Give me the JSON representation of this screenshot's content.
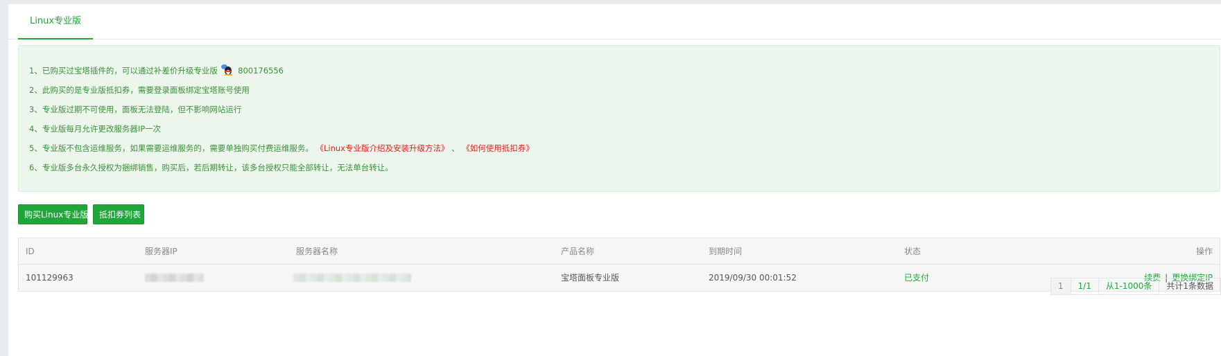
{
  "tab": {
    "label": "Linux专业版"
  },
  "notice": {
    "items": [
      "1、已购买过宝塔插件的，可以通过补差价升级专业版",
      "2、此购买的是专业版抵扣券，需要登录面板绑定宝塔账号使用",
      "3、专业版过期不可使用，面板无法登陆，但不影响网站运行",
      "4、专业版每月允许更改服务器IP一次",
      "5、专业版不包含运维服务，如果需要运维服务的，需要单独购买付费运维服务。",
      "6、专业版多台永久授权为捆绑销售，购买后，若后期转让，该多台授权只能全部转让，无法单台转让。"
    ],
    "qq_number": "800176556",
    "qq_icon": "qq-penguin-icon",
    "link_intro": "《Linux专业版介绍及安装升级方法》",
    "link_sep": "、",
    "link_coupon": "《如何使用抵扣券》"
  },
  "buttons": {
    "buy": "购买Linux专业版",
    "coupon_list": "抵扣券列表"
  },
  "table": {
    "headers": [
      "ID",
      "服务器IP",
      "服务器名称",
      "产品名称",
      "到期时间",
      "状态",
      "操作"
    ],
    "rows": [
      {
        "id": "101129963",
        "product": "宝塔面板专业版",
        "expire": "2019/09/30 00:01:52",
        "status": "已支付",
        "action_renew": "续费",
        "action_sep": "|",
        "action_rebind": "更换绑定IP"
      }
    ]
  },
  "pager": {
    "current": "1",
    "pages": "1/1",
    "range": "从1-1000条",
    "total": "共计1条数据"
  },
  "colors": {
    "accent": "#20a53a",
    "link_red": "#e02020",
    "notice_bg": "#ecf6ec"
  }
}
